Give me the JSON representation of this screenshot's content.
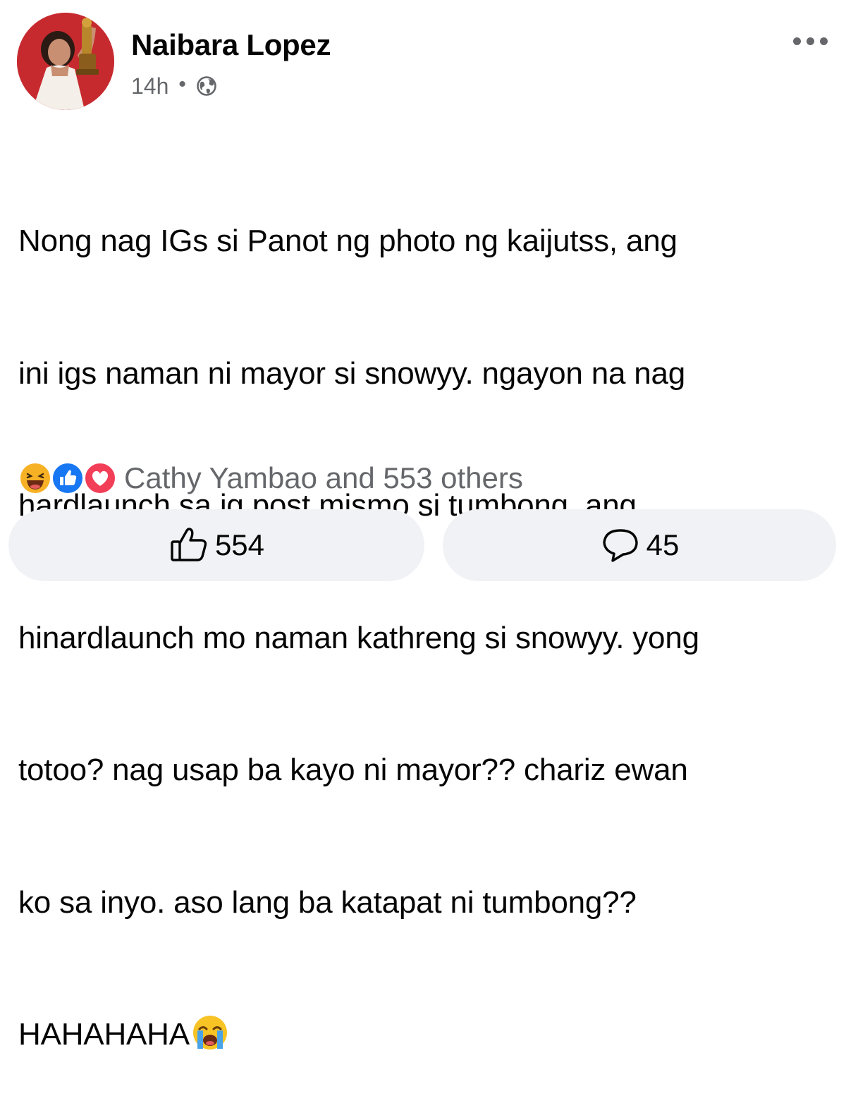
{
  "post": {
    "author": "Naibara Lopez",
    "timestamp": "14h",
    "separator": "•",
    "privacy_icon": "globe-icon",
    "text_lines": [
      "Nong nag IGs si Panot ng photo ng kaijutss, ang",
      "ini igs naman ni mayor si snowyy. ngayon na nag",
      "hardlaunch sa ig post mismo si tumbong, ang",
      "hinardlaunch mo naman kathreng si snowyy. yong",
      "totoo? nag usap ba kayo ni mayor?? chariz ewan",
      "ko sa inyo. aso lang ba katapat ni tumbong??",
      "HAHAHAHA"
    ],
    "trailing_emoji": "loudly-crying-face-emoji"
  },
  "reactions": {
    "icons": [
      "haha-reaction-icon",
      "like-reaction-icon",
      "love-reaction-icon"
    ],
    "summary": "Cathy Yambao and 553 others"
  },
  "actions": {
    "like_count": "554",
    "comment_count": "45"
  },
  "colors": {
    "text_primary": "#050505",
    "text_secondary": "#65676b",
    "pill_background": "#f0f2f5",
    "like_blue": "#1877f2",
    "love_red": "#f33e58",
    "haha_yellow": "#f7b125",
    "avatar_bg": "#c62a2f"
  }
}
